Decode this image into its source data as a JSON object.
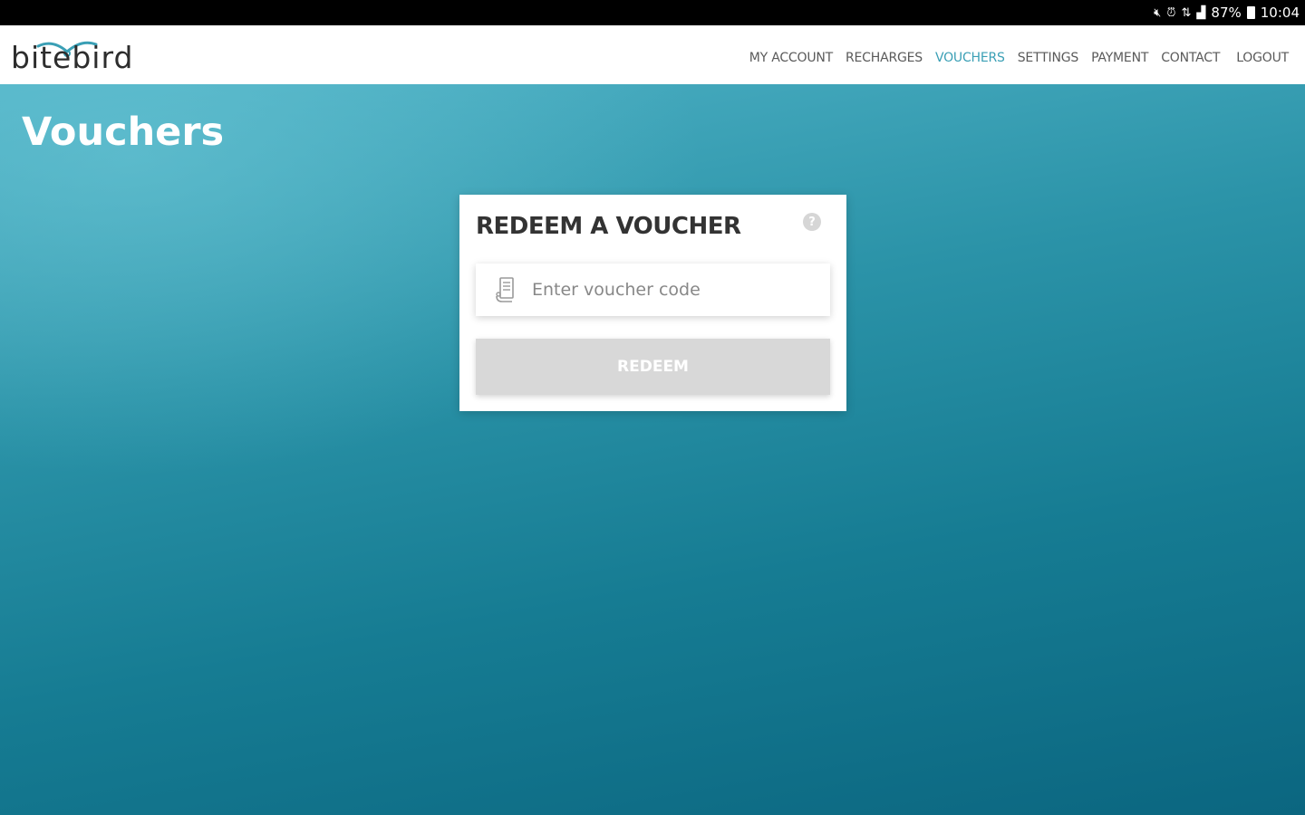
{
  "status_bar": {
    "icons": [
      "mute-icon",
      "alarm-icon",
      "wifi-icon",
      "signal-icon"
    ],
    "battery_text": "87%",
    "time": "10:04"
  },
  "header": {
    "logo_text": "bitebird",
    "nav": [
      {
        "label": "MY ACCOUNT",
        "active": false
      },
      {
        "label": "RECHARGES",
        "active": false
      },
      {
        "label": "VOUCHERS",
        "active": true
      },
      {
        "label": "SETTINGS",
        "active": false
      },
      {
        "label": "PAYMENT",
        "active": false
      },
      {
        "label": "CONTACT",
        "active": false
      },
      {
        "label": "LOGOUT",
        "active": false
      }
    ]
  },
  "main": {
    "page_title": "Vouchers",
    "card": {
      "title": "REDEEM A VOUCHER",
      "help_icon": "?",
      "voucher_input": {
        "value": "",
        "placeholder": "Enter voucher code"
      },
      "redeem_label": "REDEEM"
    }
  },
  "colors": {
    "accent": "#3a9fb5",
    "button_disabled": "#d8d8d8",
    "gradient_top": "#4fb2c6",
    "gradient_bottom": "#0b6680"
  }
}
